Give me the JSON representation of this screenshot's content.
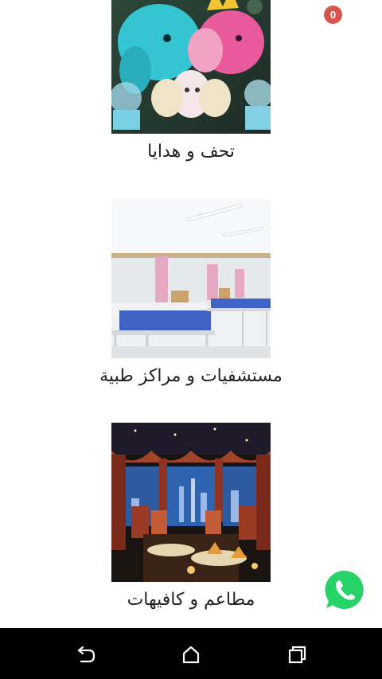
{
  "cart": {
    "badge_count": "0",
    "badge_color": "#d9534f"
  },
  "categories": [
    {
      "label": "تحف و هدايا",
      "image": "plush-toys-gifts-photo"
    },
    {
      "label": "مستشفيات و مراكز طبية",
      "image": "hospital-ward-beds-photo"
    },
    {
      "label": "مطاعم و كافيهات",
      "image": "restaurant-night-view-photo"
    }
  ],
  "floating": {
    "icon": "whatsapp-icon",
    "color": "#25d366"
  },
  "navbar": {
    "icons": [
      "back-icon",
      "home-icon",
      "recent-apps-icon"
    ]
  }
}
